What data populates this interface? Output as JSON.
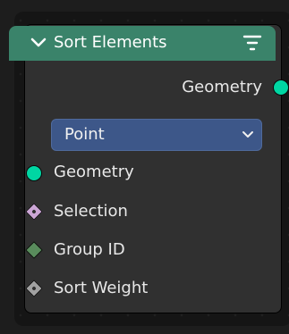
{
  "node": {
    "title": "Sort Elements",
    "header_color": "#3a836a",
    "icons": {
      "collapse": "chevron-down-icon",
      "menu": "filter-icon"
    },
    "output": {
      "label": "Geometry",
      "socket_color": "#00d6a3"
    },
    "domain": {
      "selected": "Point",
      "icon": "chevron-down-icon",
      "color": "#3d5789"
    },
    "inputs": [
      {
        "label": "Geometry",
        "socket": "circle",
        "color": "#00d6a3"
      },
      {
        "label": "Selection",
        "socket": "diamond-dot",
        "color": "#cca6d6"
      },
      {
        "label": "Group ID",
        "socket": "diamond",
        "color": "#598c5c"
      },
      {
        "label": "Sort Weight",
        "socket": "diamond-dot",
        "color": "#a1a1a1"
      }
    ]
  }
}
